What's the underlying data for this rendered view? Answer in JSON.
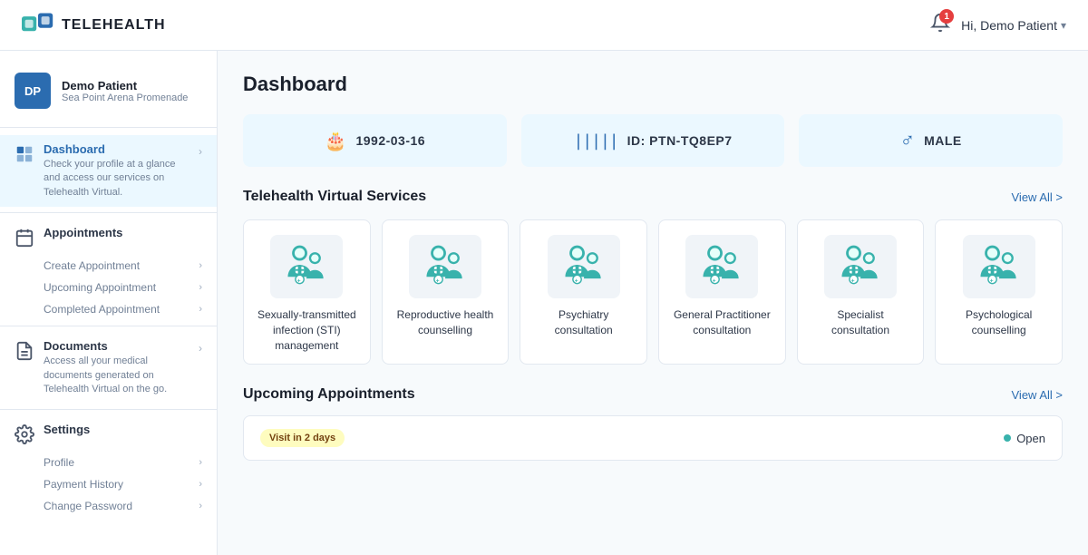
{
  "topnav": {
    "logo_text": "TELEHEALTH",
    "notification_count": "1",
    "greeting": "Hi, Demo Patient"
  },
  "sidebar": {
    "profile": {
      "initials": "DP",
      "name": "Demo Patient",
      "location": "Sea Point Arena Promenade"
    },
    "nav": [
      {
        "id": "dashboard",
        "label": "Dashboard",
        "description": "Check your profile at a glance and access our services on Telehealth Virtual.",
        "active": true,
        "subitems": []
      },
      {
        "id": "appointments",
        "label": "Appointments",
        "description": "",
        "active": false,
        "subitems": [
          "Create Appointment",
          "Upcoming Appointment",
          "Completed Appointment"
        ]
      },
      {
        "id": "documents",
        "label": "Documents",
        "description": "Access all your medical documents generated on Telehealth Virtual on the go.",
        "active": false,
        "subitems": []
      },
      {
        "id": "settings",
        "label": "Settings",
        "description": "",
        "active": false,
        "subitems": [
          "Profile",
          "Payment History",
          "Change Password"
        ]
      }
    ]
  },
  "main": {
    "page_title": "Dashboard",
    "info_cards": [
      {
        "id": "dob",
        "icon": "🎂",
        "text": "1992-03-16"
      },
      {
        "id": "patient_id",
        "icon": "|||",
        "text": "ID: PTN-TQ8EP7"
      },
      {
        "id": "gender",
        "icon": "♂",
        "text": "MALE"
      }
    ],
    "services_section": {
      "title": "Telehealth Virtual Services",
      "view_all": "View All >",
      "cards": [
        {
          "id": "sti",
          "label": "Sexually-transmitted infection (STI) management"
        },
        {
          "id": "reproductive",
          "label": "Reproductive health counselling"
        },
        {
          "id": "psychiatry",
          "label": "Psychiatry consultation"
        },
        {
          "id": "gp",
          "label": "General Practitioner consultation"
        },
        {
          "id": "specialist",
          "label": "Specialist consultation"
        },
        {
          "id": "psychological",
          "label": "Psychological counselling"
        }
      ]
    },
    "appointments_section": {
      "title": "Upcoming Appointments",
      "view_all": "View All >",
      "items": [
        {
          "badge": "Visit in 2 days",
          "status": "Open"
        }
      ]
    }
  }
}
